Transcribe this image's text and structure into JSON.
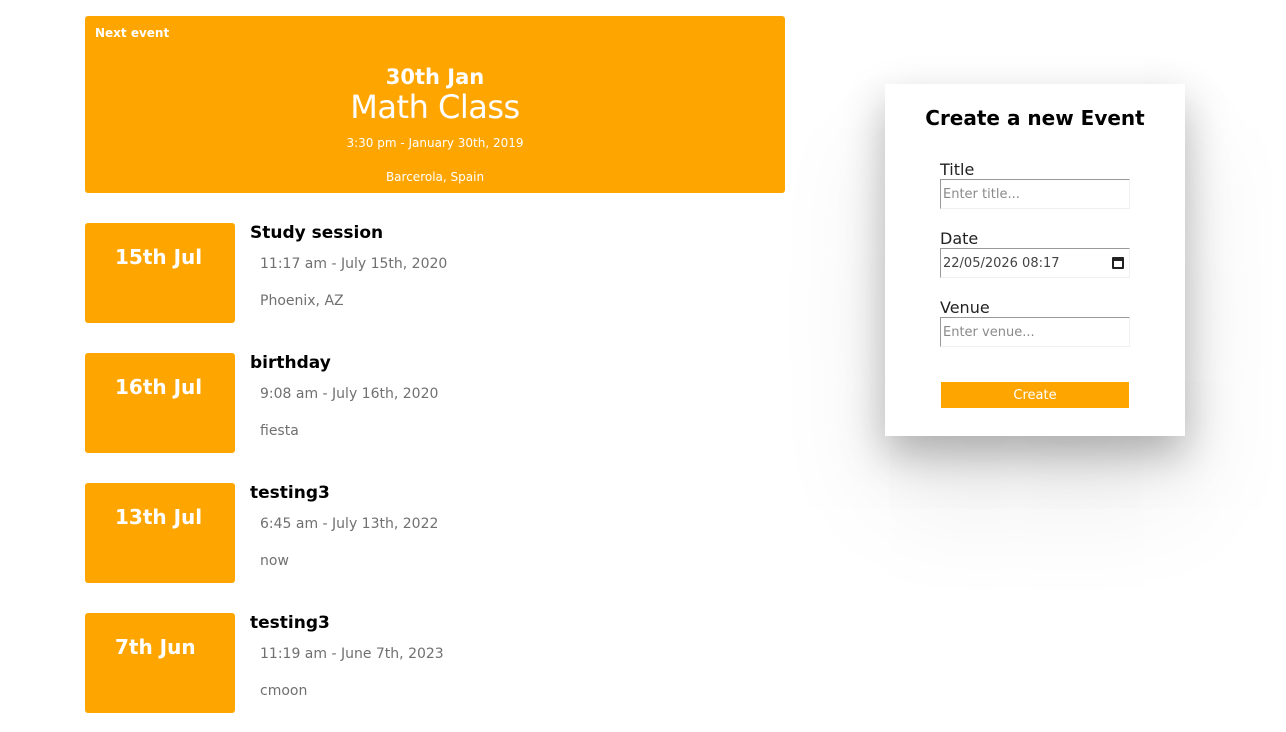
{
  "next_event": {
    "label": "Next event",
    "date": "30th Jan",
    "title": "Math Class",
    "time": "3:30 pm - January 30th, 2019",
    "venue": "Barcerola, Spain"
  },
  "events": [
    {
      "date": "15th Jul",
      "title": "Study session",
      "time": "11:17 am - July 15th, 2020",
      "venue": "Phoenix, AZ"
    },
    {
      "date": "16th Jul",
      "title": "birthday",
      "time": "9:08 am - July 16th, 2020",
      "venue": "fiesta"
    },
    {
      "date": "13th Jul",
      "title": "testing3",
      "time": "6:45 am - July 13th, 2022",
      "venue": "now"
    },
    {
      "date": "7th Jun",
      "title": "testing3",
      "time": "11:19 am - June 7th, 2023",
      "venue": "cmoon"
    }
  ],
  "create_form": {
    "title": "Create a new Event",
    "title_label": "Title",
    "title_placeholder": "Enter title...",
    "date_label": "Date",
    "date_value": "22/05/2026 08:17",
    "venue_label": "Venue",
    "venue_placeholder": "Enter venue...",
    "submit_label": "Create"
  },
  "colors": {
    "accent": "#ffa500",
    "muted_text": "#707070"
  }
}
